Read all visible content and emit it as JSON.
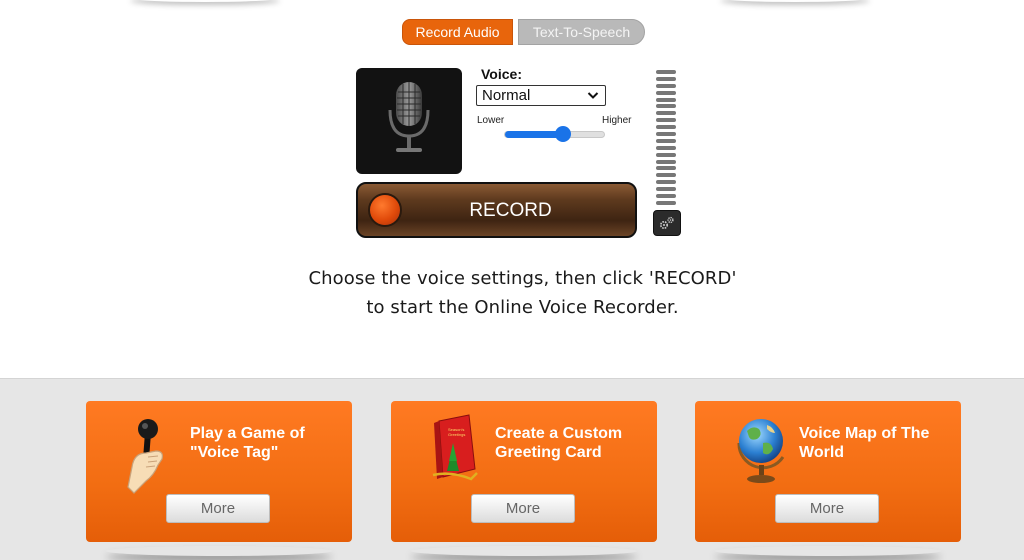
{
  "tabs": [
    {
      "label": "Record Audio",
      "active": true
    },
    {
      "label": "Text-To-Speech",
      "active": false
    }
  ],
  "voice": {
    "label": "Voice:",
    "selected": "Normal",
    "pitch_lower_label": "Lower",
    "pitch_higher_label": "Higher",
    "pitch_fraction": 0.59
  },
  "record": {
    "label": "RECORD"
  },
  "instructions": {
    "line1": "Choose the voice settings, then click 'RECORD'",
    "line2": "to start the Online Voice Recorder."
  },
  "cards": [
    {
      "title": "Play a Game of \"Voice Tag\"",
      "icon": "microphone-hand-icon",
      "more_label": "More"
    },
    {
      "title": "Create a Custom Greeting Card",
      "icon": "greeting-card-icon",
      "more_label": "More"
    },
    {
      "title": "Voice Map of The World",
      "icon": "globe-icon",
      "more_label": "More"
    }
  ],
  "colors": {
    "accent": "#e8650c",
    "card": "#f26d12",
    "slider": "#1a73e8",
    "tab_inactive": "#b9b9b9"
  }
}
